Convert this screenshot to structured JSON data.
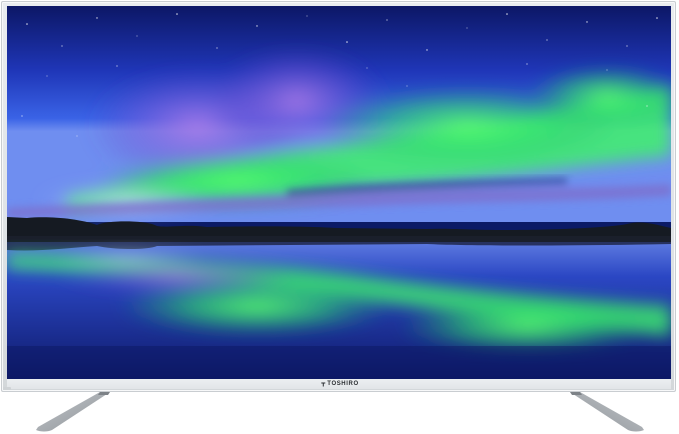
{
  "product": {
    "brand_name": "TOSHIRO",
    "logo_icon": "brand-mark-icon",
    "frame_color": "#e3e6e9",
    "stand_color": "#a9aeb3"
  },
  "screen_image": {
    "scene": "aurora-over-lake",
    "colors": {
      "sky_top": "#0e1a6e",
      "sky_mid": "#2a4fd6",
      "aurora_green": "#39f36a",
      "aurora_purple": "#8e5bd9",
      "treeline": "#151a22",
      "water": "#1c33a8"
    }
  }
}
